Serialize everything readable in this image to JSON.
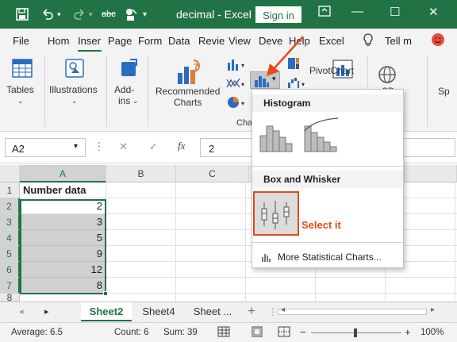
{
  "title_bar": {
    "title": "decimal  -  Excel",
    "sign_in_label": "Sign in",
    "icons": [
      "save-icon",
      "undo-icon",
      "redo-icon",
      "spelling-icon",
      "touch-mode-icon",
      "restore-icon",
      "minimize-icon",
      "maximize-icon",
      "close-icon"
    ],
    "accent_color": "#217346"
  },
  "ribbon_tabs": {
    "items": [
      "File",
      "Hom",
      "Inser",
      "Page",
      "Form",
      "Data",
      "Revie",
      "View",
      "Deve",
      "Help",
      "Excel"
    ],
    "active": "Inser",
    "tell_me": "Tell m"
  },
  "ribbon": {
    "tables_label": "Tables",
    "illustrations_label": "Illustrations",
    "addins_label": "Add-\nins",
    "recommended_charts_label": "Recommended\nCharts",
    "pivotchart_label": "PivotChart",
    "threed_label": "3D",
    "sp_label": "Sp",
    "charts_group_label": "Cha"
  },
  "formula_bar": {
    "name_box": "A2",
    "fx_symbol": "fx",
    "cancel_symbol": "✕",
    "enter_symbol": "✓",
    "value": "2"
  },
  "grid": {
    "columns": [
      "A",
      "B",
      "C"
    ],
    "selected_column": "A",
    "rows": [
      "1",
      "2",
      "3",
      "4",
      "5",
      "6",
      "7",
      "8"
    ],
    "header_cell": "Number data",
    "values": [
      "2",
      "3",
      "5",
      "9",
      "12",
      "8"
    ]
  },
  "sheet_tabs": {
    "items": [
      "Sheet2",
      "Sheet4",
      "Sheet ..."
    ],
    "active": "Sheet2",
    "add_symbol": "+"
  },
  "status_bar": {
    "average": "Average: 6.5",
    "count": "Count: 6",
    "sum": "Sum: 39",
    "zoom": "100%",
    "zoom_minus": "−",
    "zoom_plus": "+"
  },
  "chart_dropdown": {
    "histogram_header": "Histogram",
    "box_whisker_header": "Box and Whisker",
    "more_charts_label": "More Statistical Charts...",
    "annotation_text": "Select it",
    "annotation_color": "#e64a19"
  }
}
